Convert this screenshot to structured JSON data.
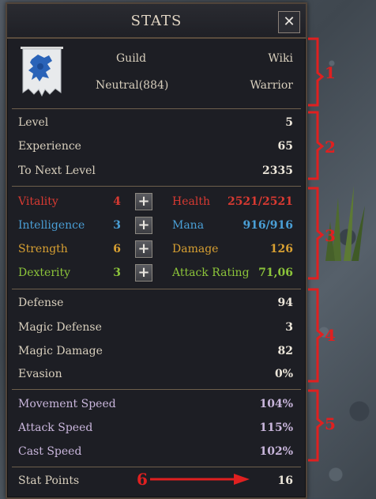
{
  "window": {
    "title": "STATS",
    "close_glyph": "✕"
  },
  "header": {
    "guild_label": "Guild",
    "wiki_label": "Wiki",
    "alignment": "Neutral(884)",
    "class_name": "Warrior",
    "emblem_icon": "blue-lion-banner-icon"
  },
  "level_section": {
    "rows": [
      {
        "label": "Level",
        "value": "5"
      },
      {
        "label": "Experience",
        "value": "65"
      },
      {
        "label": "To Next Level",
        "value": "2335"
      }
    ]
  },
  "attributes": {
    "rows": [
      {
        "label": "Vitality",
        "value": "4",
        "color": "#d93a32",
        "derived_label": "Health",
        "derived_value": "2521/2521",
        "derived_color": "#d93a32"
      },
      {
        "label": "Intelligence",
        "value": "3",
        "color": "#4a9fd6",
        "derived_label": "Mana",
        "derived_value": "916/916",
        "derived_color": "#4a9fd6"
      },
      {
        "label": "Strength",
        "value": "6",
        "color": "#d8a032",
        "derived_label": "Damage",
        "derived_value": "126",
        "derived_color": "#d8a032"
      },
      {
        "label": "Dexterity",
        "value": "3",
        "color": "#8cc43a",
        "derived_label": "Attack Rating",
        "derived_value": "71,06",
        "derived_color": "#8cc43a"
      }
    ],
    "plus_glyph": "+"
  },
  "defense_section": {
    "rows": [
      {
        "label": "Defense",
        "value": "94"
      },
      {
        "label": "Magic Defense",
        "value": "3"
      },
      {
        "label": "Magic Damage",
        "value": "82"
      },
      {
        "label": "Evasion",
        "value": "0%"
      }
    ]
  },
  "speed_section": {
    "rows": [
      {
        "label": "Movement Speed",
        "value": "104%"
      },
      {
        "label": "Attack Speed",
        "value": "115%"
      },
      {
        "label": "Cast Speed",
        "value": "102%"
      }
    ],
    "color": "#c9b6dc"
  },
  "stat_points": {
    "label": "Stat Points",
    "value": "16"
  },
  "annotations": {
    "labels": [
      "1",
      "2",
      "3",
      "4",
      "5",
      "6"
    ],
    "color": "#e02020"
  }
}
